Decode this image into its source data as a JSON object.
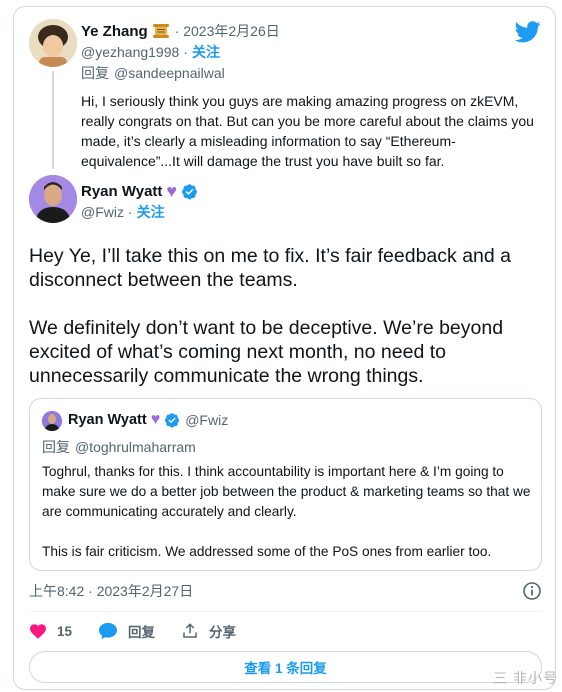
{
  "tweet_reply": {
    "author_name": "Ye Zhang",
    "date": "· 2023年2月26日",
    "handle": "@yezhang1998",
    "separator": "·",
    "follow": "关注",
    "replying_prefix": "回复",
    "replying_to": "@sandeepnailwal",
    "text": "Hi, I seriously think you guys are making amazing progress on zkEVM, really congrats on that. But can you be more careful about the claims you made, it’s clearly a misleading information to say “Ethereum-equivalence”...It will damage the trust you have built so far."
  },
  "tweet_main": {
    "author_name": "Ryan Wyatt",
    "handle": "@Fwiz",
    "separator": "·",
    "follow": "关注",
    "paragraph_1": "Hey Ye, I’ll take this on me to fix. It’s fair feedback and a disconnect between the teams.",
    "paragraph_2": "We definitely don’t want to be deceptive. We’re beyond excited of what’s coming next month, no need to unnecessarily communicate the wrong things."
  },
  "quoted_tweet": {
    "author_name": "Ryan Wyatt",
    "handle": "@Fwiz",
    "replying_prefix": "回复",
    "replying_to": "@toghrulmaharram",
    "paragraph_1": "Toghrul, thanks for this. I think accountability is important here & I’m going to make sure we do a better job between the product & marketing teams so that we are communicating accurately and clearly.",
    "paragraph_2": "This is fair criticism. We addressed some of the PoS ones from earlier too."
  },
  "timestamp": "上午8:42 · 2023年2月27日",
  "actions": {
    "like_count": "15",
    "reply_label": "回复",
    "share_label": "分享"
  },
  "more_replies_label": "查看 1 条回复",
  "watermark": "三 非小号",
  "colors": {
    "accent": "#1d9bf0",
    "heart": "#f91880",
    "muted": "#536471",
    "border": "#cfd9de"
  },
  "icons": [
    "twitter-bird-icon",
    "scroll-emoji-icon",
    "purple-heart-icon",
    "verified-badge-icon",
    "info-icon",
    "heart-icon",
    "reply-bubble-icon",
    "share-icon"
  ]
}
